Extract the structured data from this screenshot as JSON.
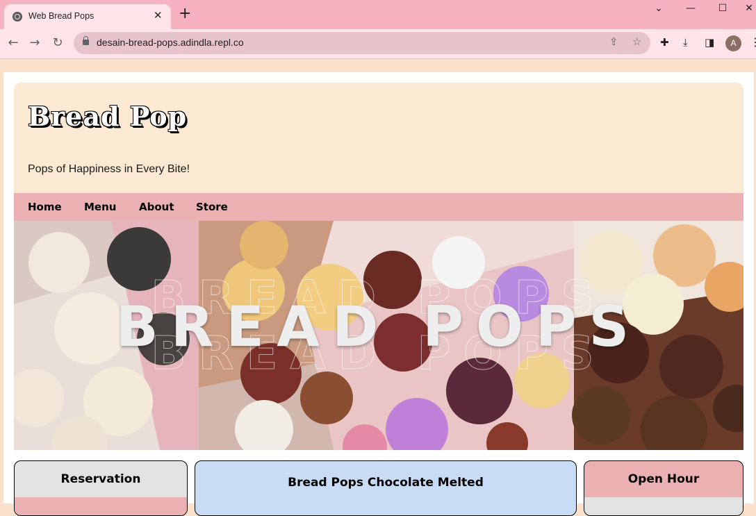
{
  "browser": {
    "tab_title": "Web Bread Pops",
    "tab_close": "✕",
    "new_tab": "+",
    "url": "desain-bread-pops.adindla.repl.co",
    "profile_initial": "A",
    "window_controls": {
      "dropdown": "⌄",
      "minimize": "—",
      "maximize": "☐",
      "close": "✕"
    }
  },
  "site": {
    "title": "Bread Pop",
    "tagline": "Pops of Happiness in Every Bite!"
  },
  "nav": {
    "items": [
      "Home",
      "Menu",
      "About",
      "Store"
    ]
  },
  "banner": {
    "text": "BREAD POPS"
  },
  "cards": [
    {
      "title": "Reservation",
      "bg": "#e3e3e3",
      "strip": "#ebb1b2"
    },
    {
      "title": "Bread Pops Chocolate Melted",
      "bg": "#c9dcf6"
    },
    {
      "title": "Open Hour",
      "bg": "#ebb1b2",
      "strip": "#e3e3e3"
    }
  ],
  "colors": {
    "tabbar": "#f7b2c1",
    "toolbar": "#ffe5ea",
    "page_bg": "#fbe1cc",
    "header_bg": "#fbe9d3",
    "navbar_bg": "#ebb1b2"
  }
}
